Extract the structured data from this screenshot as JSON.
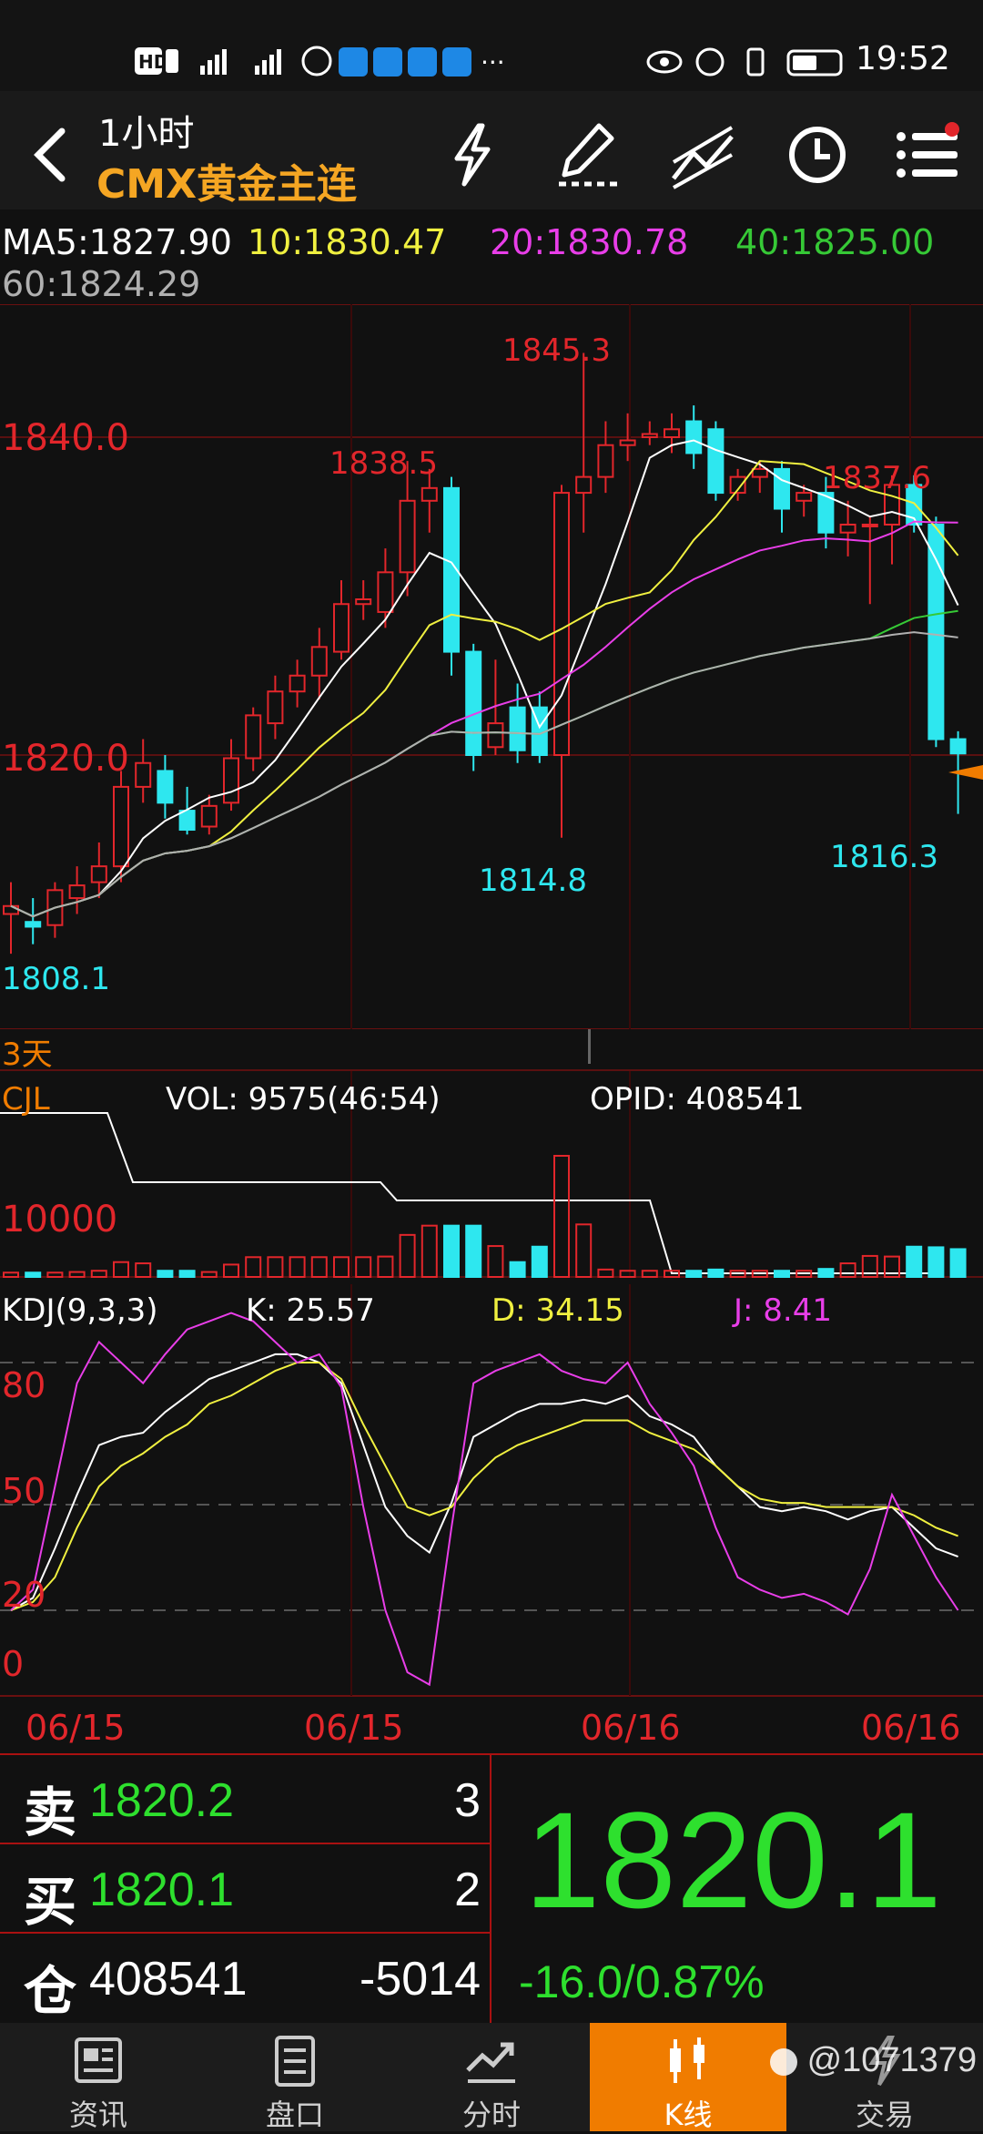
{
  "status_bar": {
    "left_icons": [
      "hd-icon",
      "signal-4g-icon",
      "signal-4g-icon",
      "palm-icon",
      "weather-icon",
      "cloud-icon",
      "search-app-icon",
      "flag-app-icon",
      "more-dots-icon"
    ],
    "sim_label": "HD",
    "more": "···",
    "right_icons": [
      "eye-icon",
      "alarm-icon",
      "vibrate-icon",
      "battery-icon"
    ],
    "time": "19:52"
  },
  "header": {
    "period": "1小时",
    "instrument": "CMX黄金主连",
    "icons": [
      "back-icon",
      "lightning-icon",
      "draw-pen-icon",
      "trend-line-icon",
      "clock-icon",
      "menu-list-icon"
    ]
  },
  "ma_legend": {
    "ma5": "MA5:1827.90",
    "ma10": "10:1830.47",
    "ma20": "20:1830.78",
    "ma40": "40:1825.00",
    "ma60": "60:1824.29"
  },
  "price_pane": {
    "level_1840": "1840.0",
    "level_1820": "1820.0",
    "annot_1845": "1845.3",
    "annot_1838": "1838.5",
    "annot_1837": "1837.6",
    "annot_1814": "1814.8",
    "annot_1816": "1816.3",
    "annot_1808": "1808.1",
    "range_label": "3天"
  },
  "volume_pane": {
    "title": "CJL",
    "vol": "VOL: 9575(46:54)",
    "opid": "OPID: 408541",
    "level": "10000"
  },
  "kdj_pane": {
    "title": "KDJ(9,3,3)",
    "k": "K: 25.57",
    "d": "D: 34.15",
    "j": "J: 8.41",
    "level_80": "80",
    "level_50": "50",
    "level_20": "20",
    "level_0": "0"
  },
  "date_axis": [
    "06/15",
    "06/15",
    "06/16",
    "06/16"
  ],
  "chart_data": {
    "type": "candlestick",
    "price_range": [
      1805,
      1848
    ],
    "candles": [
      {
        "o": 1810.0,
        "h": 1812.0,
        "l": 1807.5,
        "c": 1810.5
      },
      {
        "o": 1809.5,
        "h": 1811.0,
        "l": 1808.1,
        "c": 1809.2
      },
      {
        "o": 1809.3,
        "h": 1812.0,
        "l": 1808.5,
        "c": 1811.5
      },
      {
        "o": 1811.0,
        "h": 1813.0,
        "l": 1810.0,
        "c": 1811.8
      },
      {
        "o": 1812.0,
        "h": 1814.5,
        "l": 1811.0,
        "c": 1813.0
      },
      {
        "o": 1813.0,
        "h": 1819.0,
        "l": 1812.0,
        "c": 1818.0
      },
      {
        "o": 1818.0,
        "h": 1821.0,
        "l": 1817.0,
        "c": 1819.5
      },
      {
        "o": 1819.0,
        "h": 1820.0,
        "l": 1816.0,
        "c": 1817.0
      },
      {
        "o": 1816.5,
        "h": 1818.0,
        "l": 1815.0,
        "c": 1815.3
      },
      {
        "o": 1815.5,
        "h": 1817.5,
        "l": 1815.0,
        "c": 1816.8
      },
      {
        "o": 1817.0,
        "h": 1821.0,
        "l": 1816.5,
        "c": 1819.8
      },
      {
        "o": 1819.8,
        "h": 1823.0,
        "l": 1819.0,
        "c": 1822.5
      },
      {
        "o": 1822.0,
        "h": 1825.0,
        "l": 1821.0,
        "c": 1824.0
      },
      {
        "o": 1824.0,
        "h": 1826.0,
        "l": 1823.0,
        "c": 1825.0
      },
      {
        "o": 1825.0,
        "h": 1828.0,
        "l": 1823.5,
        "c": 1826.8
      },
      {
        "o": 1826.5,
        "h": 1831.0,
        "l": 1826.0,
        "c": 1829.5
      },
      {
        "o": 1829.5,
        "h": 1831.0,
        "l": 1828.5,
        "c": 1829.8
      },
      {
        "o": 1829.0,
        "h": 1833.0,
        "l": 1828.0,
        "c": 1831.5
      },
      {
        "o": 1831.5,
        "h": 1838.5,
        "l": 1830.0,
        "c": 1836.0
      },
      {
        "o": 1836.0,
        "h": 1838.0,
        "l": 1834.0,
        "c": 1836.8
      },
      {
        "o": 1836.8,
        "h": 1837.5,
        "l": 1825.0,
        "c": 1826.5
      },
      {
        "o": 1826.5,
        "h": 1827.0,
        "l": 1819.0,
        "c": 1820.0
      },
      {
        "o": 1820.5,
        "h": 1826.0,
        "l": 1820.0,
        "c": 1822.0
      },
      {
        "o": 1823.0,
        "h": 1824.5,
        "l": 1819.5,
        "c": 1820.3
      },
      {
        "o": 1823.0,
        "h": 1824.0,
        "l": 1819.5,
        "c": 1820.0
      },
      {
        "o": 1820.0,
        "h": 1837.0,
        "l": 1814.8,
        "c": 1836.5
      },
      {
        "o": 1836.5,
        "h": 1845.3,
        "l": 1834.0,
        "c": 1837.5
      },
      {
        "o": 1837.5,
        "h": 1841.0,
        "l": 1836.5,
        "c": 1839.5
      },
      {
        "o": 1839.5,
        "h": 1841.5,
        "l": 1838.5,
        "c": 1839.8
      },
      {
        "o": 1840.0,
        "h": 1841.0,
        "l": 1839.5,
        "c": 1840.2
      },
      {
        "o": 1840.0,
        "h": 1841.5,
        "l": 1839.0,
        "c": 1840.5
      },
      {
        "o": 1841.0,
        "h": 1842.0,
        "l": 1838.0,
        "c": 1839.0
      },
      {
        "o": 1840.5,
        "h": 1841.0,
        "l": 1836.0,
        "c": 1836.5
      },
      {
        "o": 1836.5,
        "h": 1838.0,
        "l": 1836.0,
        "c": 1837.5
      },
      {
        "o": 1837.5,
        "h": 1838.5,
        "l": 1836.5,
        "c": 1838.0
      },
      {
        "o": 1838.0,
        "h": 1838.5,
        "l": 1834.0,
        "c": 1835.5
      },
      {
        "o": 1836.0,
        "h": 1837.0,
        "l": 1835.0,
        "c": 1836.5
      },
      {
        "o": 1836.5,
        "h": 1837.5,
        "l": 1833.0,
        "c": 1834.0
      },
      {
        "o": 1834.0,
        "h": 1836.0,
        "l": 1832.5,
        "c": 1834.5
      },
      {
        "o": 1834.5,
        "h": 1835.0,
        "l": 1829.5,
        "c": 1834.5
      },
      {
        "o": 1834.5,
        "h": 1837.6,
        "l": 1832.0,
        "c": 1837.0
      },
      {
        "o": 1837.0,
        "h": 1837.6,
        "l": 1834.0,
        "c": 1834.5
      },
      {
        "o": 1834.5,
        "h": 1835.0,
        "l": 1820.5,
        "c": 1821.0
      },
      {
        "o": 1821.0,
        "h": 1821.5,
        "l": 1816.3,
        "c": 1820.1
      }
    ],
    "volume_ref": 10000,
    "volume_max": 28000,
    "volumes": [
      700,
      700,
      700,
      800,
      1000,
      2400,
      2200,
      1000,
      1000,
      800,
      2000,
      3200,
      3200,
      3200,
      3200,
      3200,
      3200,
      3300,
      6800,
      8300,
      8300,
      8300,
      5000,
      2400,
      4900,
      19600,
      8500,
      1200,
      1000,
      1000,
      1000,
      1000,
      1200,
      1000,
      1000,
      1000,
      1000,
      1300,
      2200,
      3400,
      3300,
      4900,
      4800,
      4500
    ],
    "kdj_k": [
      20,
      23,
      35,
      48,
      60,
      62,
      63,
      68,
      72,
      76,
      78,
      80,
      82,
      82,
      80,
      75,
      60,
      45,
      38,
      34,
      46,
      62,
      65,
      68,
      70,
      70,
      71,
      70,
      72,
      67,
      65,
      62,
      55,
      50,
      45,
      44,
      45,
      44,
      42,
      44,
      45,
      40,
      35,
      33
    ],
    "kdj_d": [
      20,
      22,
      28,
      40,
      50,
      55,
      58,
      62,
      65,
      70,
      72,
      75,
      78,
      80,
      80,
      76,
      65,
      55,
      45,
      43,
      45,
      52,
      57,
      60,
      62,
      64,
      66,
      66,
      66,
      63,
      61,
      59,
      55,
      50,
      47,
      46,
      46,
      45,
      45,
      45,
      45,
      43,
      40,
      38
    ],
    "kdj_j": [
      20,
      25,
      50,
      75,
      85,
      80,
      75,
      82,
      88,
      90,
      92,
      90,
      85,
      80,
      82,
      74,
      45,
      20,
      5,
      2,
      40,
      75,
      78,
      80,
      82,
      78,
      76,
      75,
      80,
      70,
      63,
      55,
      40,
      28,
      25,
      23,
      24,
      22,
      19,
      30,
      48,
      38,
      28,
      20
    ]
  },
  "quote": {
    "sell_label": "卖",
    "sell_price": "1820.2",
    "sell_qty": "3",
    "buy_label": "买",
    "buy_price": "1820.1",
    "buy_qty": "2",
    "oi_label": "仓",
    "oi_value": "408541",
    "oi_change": "-5014",
    "last_price": "1820.1",
    "change": "-16.0/0.87%"
  },
  "nav": [
    {
      "label": "资讯",
      "icon": "news-icon"
    },
    {
      "label": "盘口",
      "icon": "orderbook-icon"
    },
    {
      "label": "分时",
      "icon": "timeshare-icon"
    },
    {
      "label": "K线",
      "icon": "kline-icon"
    },
    {
      "label": "交易",
      "icon": "trade-icon"
    }
  ],
  "watermark": "@1071379",
  "colors": {
    "bg": "#111111",
    "up": "#e2262b",
    "down": "#2ee7ef",
    "ma5": "#ffffff",
    "ma10": "#f0f040",
    "ma20": "#e83ee8",
    "ma40": "#36c936",
    "ma60": "#b0b0b0",
    "accent_orange": "#f07c00",
    "quote_green": "#2ee02e"
  }
}
